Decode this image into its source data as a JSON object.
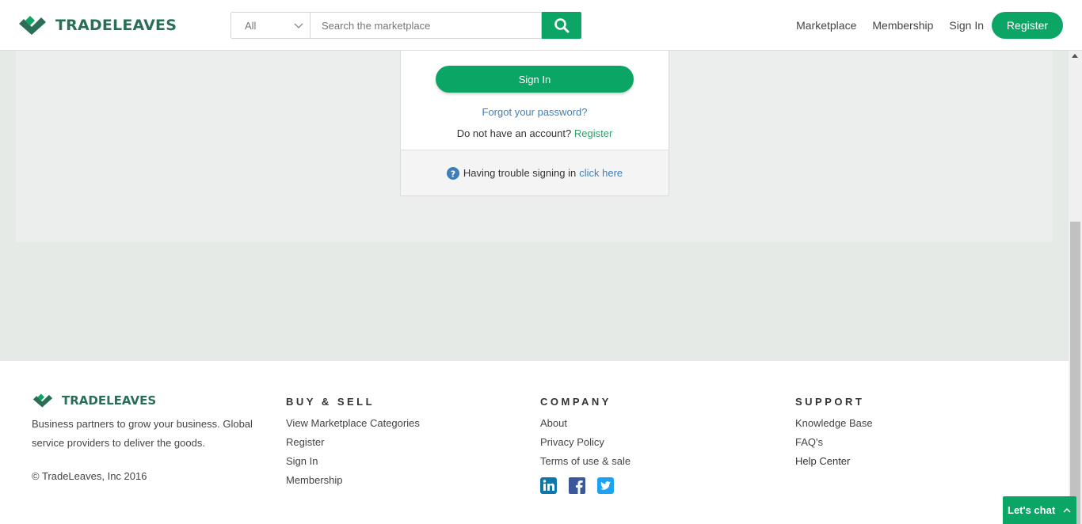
{
  "header": {
    "brand": "TRADELEAVES",
    "category_selected": "All",
    "search_placeholder": "Search the marketplace",
    "nav": {
      "marketplace": "Marketplace",
      "membership": "Membership",
      "signin": "Sign In",
      "register": "Register"
    }
  },
  "card": {
    "signin_button": "Sign In",
    "forgot_password": "Forgot your password?",
    "no_account_text": "Do not have an account?",
    "register_link": "Register",
    "trouble_text": "Having trouble signing in",
    "trouble_link": "click here"
  },
  "footer": {
    "brand": "TRADELEAVES",
    "description": "Business partners to grow your business. Global service providers to deliver the goods.",
    "copyright": "© TradeLeaves, Inc 2016",
    "buy_sell": {
      "heading": "BUY & SELL",
      "links": [
        "View Marketplace Categories",
        "Register",
        "Sign In",
        "Membership"
      ]
    },
    "company": {
      "heading": "COMPANY",
      "links": [
        "About",
        "Privacy Policy",
        "Terms of use & sale"
      ]
    },
    "support": {
      "heading": "SUPPORT",
      "links": [
        "Knowledge Base",
        "FAQ's",
        "Help Center"
      ]
    },
    "socials": [
      "linkedin-icon",
      "facebook-icon",
      "twitter-icon"
    ]
  },
  "chat": {
    "label": "Let's chat"
  },
  "colors": {
    "accent": "#0ba566",
    "brand": "#2a6e56",
    "link": "#3f7fb9",
    "linkedin": "#0e76a8",
    "facebook": "#3b5998",
    "twitter": "#1da1f2"
  }
}
